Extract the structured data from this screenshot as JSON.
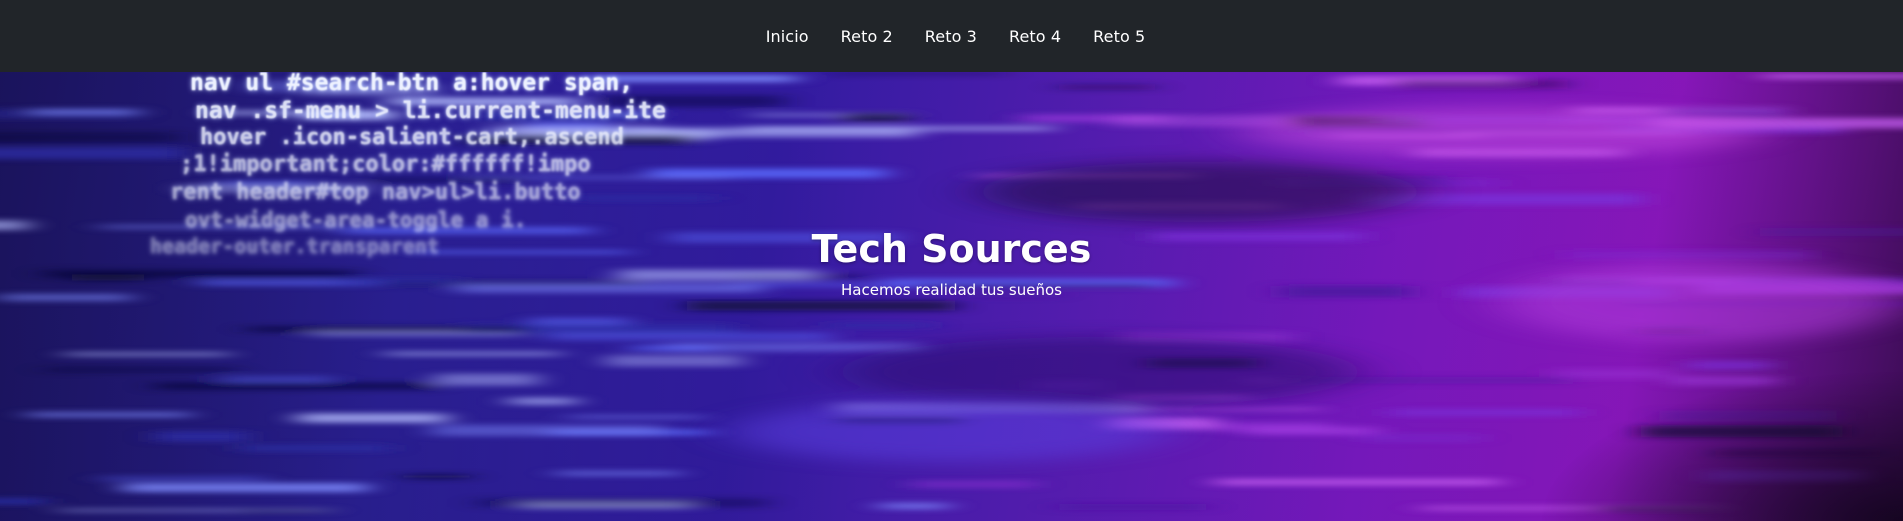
{
  "navbar": {
    "items": [
      {
        "label": "Inicio"
      },
      {
        "label": "Reto 2"
      },
      {
        "label": "Reto 3"
      },
      {
        "label": "Reto 4"
      },
      {
        "label": "Reto 5"
      }
    ]
  },
  "hero": {
    "title": "Tech Sources",
    "subtitle": "Hacemos realidad tus sueños",
    "code_lines": [
      "nav ul #search-btn a:hover span,",
      "nav .sf-menu > li.current-menu-ite",
      "hover .icon-salient-cart,.ascend",
      ";1!important;color:#ffffff!impo",
      "rent header#top nav>ul>li.butto",
      "ovt-widget-area-toggle a i.",
      "header-outer.transparent"
    ]
  },
  "colors": {
    "navbar_bg": "#212529",
    "text": "#ffffff",
    "hero_blue": "#3a2ac9",
    "hero_purple": "#8a17bd"
  }
}
